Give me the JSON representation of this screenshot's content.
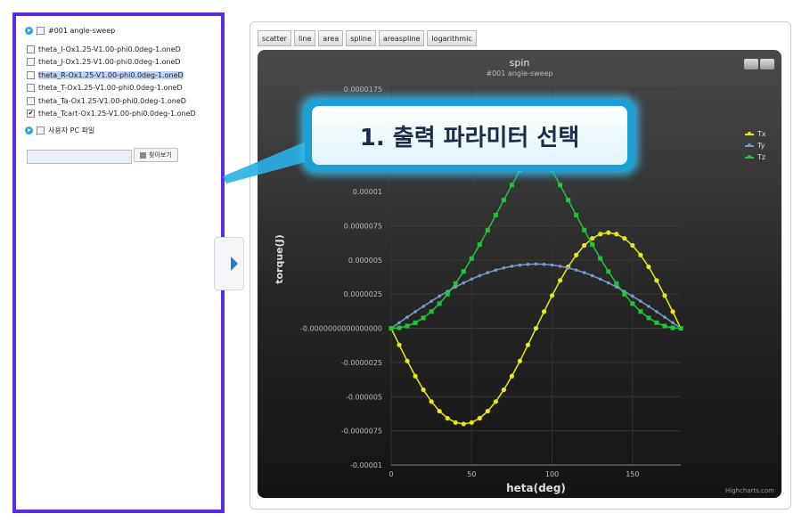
{
  "sidebar": {
    "root_label": "#001 angle-sweep",
    "files": [
      {
        "label": "theta_I-Ox1.25-V1.00-phi0.0deg-1.oneD",
        "checked": false,
        "highlight": false
      },
      {
        "label": "theta_J-Ox1.25-V1.00-phi0.0deg-1.oneD",
        "checked": false,
        "highlight": false
      },
      {
        "label": "theta_R-Ox1.25-V1.00-phi0.0deg-1.oneD",
        "checked": false,
        "highlight": true
      },
      {
        "label": "theta_T-Ox1.25-V1.00-phi0.0deg-1.oneD",
        "checked": false,
        "highlight": false
      },
      {
        "label": "theta_Ta-Ox1.25-V1.00-phi0.0deg-1.oneD",
        "checked": false,
        "highlight": false
      },
      {
        "label": "theta_Tcart-Ox1.25-V1.00-phi0.0deg-1.oneD",
        "checked": true,
        "highlight": false
      }
    ],
    "upload_label": "사용자 PC 파일",
    "path_value": "",
    "browse_label": "찾아보기"
  },
  "toolbar": {
    "buttons": [
      "scatter",
      "line",
      "area",
      "spline",
      "areaspline",
      "logarithmic"
    ]
  },
  "callout": {
    "text": "1. 출력 파라미터 선택"
  },
  "colors": {
    "accent": "#5a2ae6",
    "callout": "#1a9fd6",
    "tx": "#e8e81c",
    "ty": "#7a9bd0",
    "tz": "#22c43a"
  },
  "chart_data": {
    "type": "line",
    "title": "spin",
    "subtitle": "#001 angle-sweep",
    "xlabel": "heta(deg)",
    "ylabel": "torque(J)",
    "xlim": [
      0,
      180
    ],
    "ylim": [
      -1e-05,
      1.75e-05
    ],
    "x_ticks": [
      "0",
      "50",
      "100",
      "150"
    ],
    "y_ticks": [
      "0.0000175",
      "0.00001",
      "0.0000075",
      "0.000005",
      "0.0000025",
      "-0.0000000000000000",
      "-0.0000025",
      "-0.000005",
      "-0.0000075",
      "-0.00001"
    ],
    "legend": "right",
    "credits": "Highcharts.com",
    "series": [
      {
        "name": "Tx",
        "color": "#e8e81c",
        "fn": "tx"
      },
      {
        "name": "Ty",
        "color": "#7a9bd0",
        "fn": "ty"
      },
      {
        "name": "Tz",
        "color": "#22c43a",
        "fn": "tz"
      }
    ]
  }
}
